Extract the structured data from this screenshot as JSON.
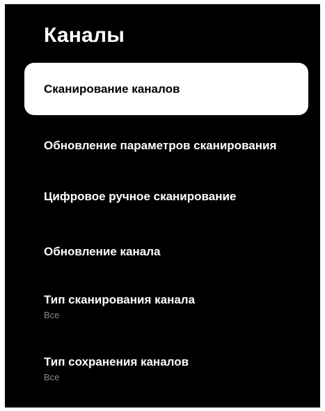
{
  "title": "Каналы",
  "menu": {
    "items": [
      {
        "label": "Сканирование каналов",
        "selected": true
      },
      {
        "label": "Обновление параметров сканирования"
      },
      {
        "label": "Цифровое ручное сканирование"
      },
      {
        "label": "Обновление канала"
      },
      {
        "label": "Тип сканирования канала",
        "value": "Все"
      },
      {
        "label": "Тип сохранения каналов",
        "value": "Все"
      }
    ]
  }
}
